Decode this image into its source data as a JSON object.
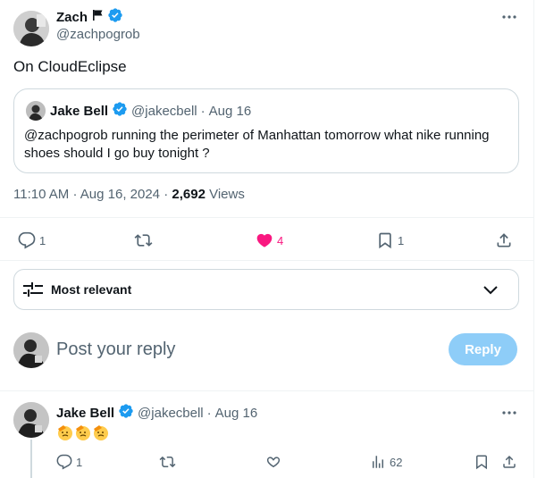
{
  "tweet": {
    "author_name": "Zach",
    "author_handle": "@zachpogrob",
    "text": "On CloudEclipse",
    "time": "11:10 AM",
    "date": "Aug 16, 2024",
    "views_count": "2,692",
    "views_label": "Views",
    "more_icon": "more-horizontal-icon",
    "flag_icon": "black-flag-icon",
    "quote": {
      "author_name": "Jake Bell",
      "author_handle": "@jakecbell",
      "date": "Aug 16",
      "text_line1": "@zachpogrob running the perimeter of Manhattan tomorrow what nike running",
      "text_line2": "shoes should I go buy tonight ?"
    },
    "actions": {
      "reply_count": "1",
      "retweet_count": "",
      "like_count": "4",
      "bookmark_count": "1"
    }
  },
  "sort": {
    "label": "Most relevant"
  },
  "composer": {
    "placeholder": "Post your reply",
    "button_label": "Reply"
  },
  "reply": {
    "author_name": "Jake Bell",
    "author_handle": "@jakecbell",
    "date": "Aug 16",
    "emoji": "🫡🫡🫡",
    "actions": {
      "reply_count": "1",
      "retweet_count": "",
      "like_count": "",
      "views_count": "62"
    }
  },
  "colors": {
    "verified": "#1d9bf0",
    "like_active": "#f91880",
    "reply_button_disabled": "#8ecdf8",
    "muted_text": "#536471",
    "border": "#cfd9de"
  }
}
